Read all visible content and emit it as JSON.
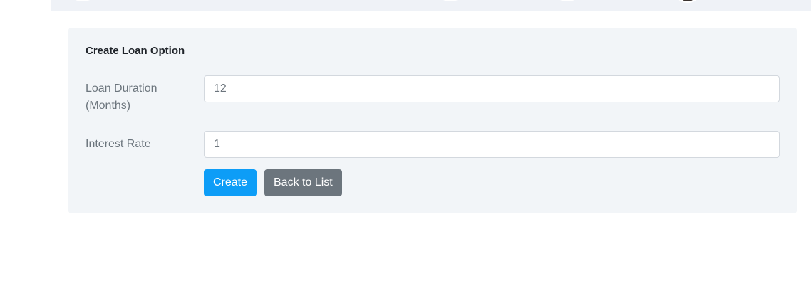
{
  "form": {
    "title": "Create Loan Option",
    "duration_label_line1": "Loan Duration",
    "duration_label_line2": "(Months)",
    "duration_value": "12",
    "interest_label": "Interest Rate",
    "interest_value": "1",
    "create_label": "Create",
    "back_label": "Back to List"
  },
  "colors": {
    "primary": "#0d9df7",
    "secondary": "#6c757d",
    "card_background": "#f2f5f8"
  }
}
